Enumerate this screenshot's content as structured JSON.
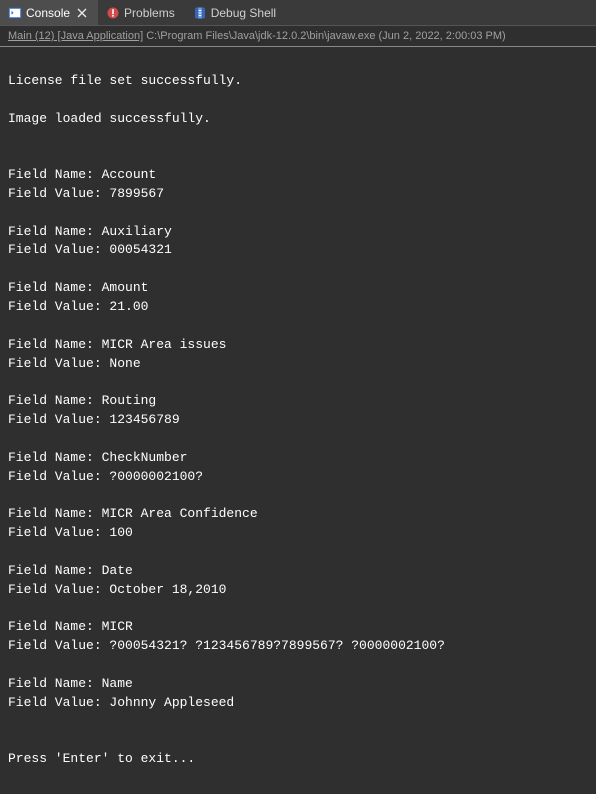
{
  "tabs": [
    {
      "label": "Console",
      "active": true,
      "closeable": true,
      "icon": "console-icon"
    },
    {
      "label": "Problems",
      "active": false,
      "closeable": false,
      "icon": "problems-icon"
    },
    {
      "label": "Debug Shell",
      "active": false,
      "closeable": false,
      "icon": "debug-shell-icon"
    }
  ],
  "process": {
    "link": "Main (12) [Java Application]",
    "path": " C:\\Program Files\\Java\\jdk-12.0.2\\bin\\javaw.exe (Jun 2, 2022, 2:00:03 PM)"
  },
  "output": {
    "init_lines": [
      "License file set successfully.",
      "Image loaded successfully."
    ],
    "field_label_prefix": "Field Name: ",
    "field_value_prefix": "Field Value: ",
    "fields": [
      {
        "name": "Account",
        "value": "7899567"
      },
      {
        "name": "Auxiliary",
        "value": "00054321"
      },
      {
        "name": "Amount",
        "value": "21.00"
      },
      {
        "name": "MICR Area issues",
        "value": "None"
      },
      {
        "name": "Routing",
        "value": "123456789"
      },
      {
        "name": "CheckNumber",
        "value": "?0000002100?"
      },
      {
        "name": "MICR Area Confidence",
        "value": "100"
      },
      {
        "name": "Date",
        "value": "October 18,2010"
      },
      {
        "name": "MICR",
        "value": "?00054321? ?123456789?7899567? ?0000002100?"
      },
      {
        "name": "Name",
        "value": "Johnny Appleseed"
      }
    ],
    "exit_prompt": "Press 'Enter' to exit..."
  }
}
